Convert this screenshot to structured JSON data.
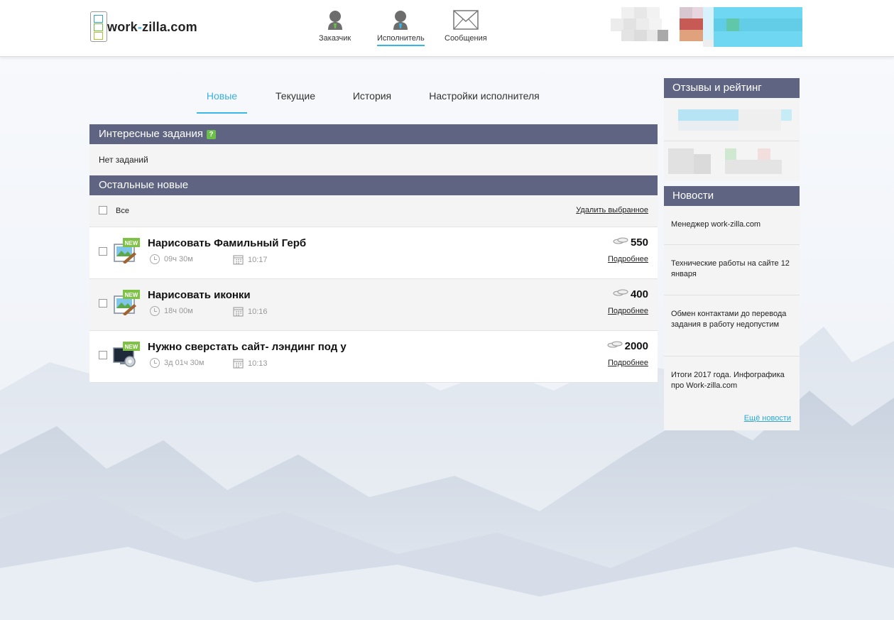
{
  "header": {
    "logo": {
      "text_main": "work",
      "text_dash": "-",
      "text_rest": "zilla.com"
    },
    "nav": [
      {
        "label": "Заказчик",
        "icon": "customer-avatar-icon",
        "active": false
      },
      {
        "label": "Исполнитель",
        "icon": "performer-avatar-icon",
        "active": true
      },
      {
        "label": "Сообщения",
        "icon": "envelope-icon",
        "active": false
      }
    ]
  },
  "tabs": [
    {
      "label": "Новые",
      "active": true
    },
    {
      "label": "Текущие",
      "active": false
    },
    {
      "label": "История",
      "active": false
    },
    {
      "label": "Настройки исполнителя",
      "active": false
    }
  ],
  "interesting": {
    "title": "Интересные задания",
    "help": "?",
    "empty_text": "Нет заданий"
  },
  "others": {
    "title": "Остальные новые",
    "select_all_label": "Все",
    "delete_selected_label": "Удалить выбранное",
    "tasks": [
      {
        "badge": "NEW",
        "title": "Нарисовать Фамильный Герб",
        "time_left": "09ч 30м",
        "time": "10:17",
        "price": "550",
        "more": "Подробнее",
        "icon": "image-edit-icon"
      },
      {
        "badge": "NEW",
        "title": "Нарисовать иконки",
        "time_left": "18ч 00м",
        "time": "10:16",
        "price": "400",
        "more": "Подробнее",
        "icon": "image-edit-icon"
      },
      {
        "badge": "NEW",
        "title": "Нужно сверстать сайт- лэндинг под у",
        "time_left": "3д 01ч 30м",
        "time": "10:13",
        "price": "2000",
        "more": "Подробнее",
        "icon": "monitor-gear-icon"
      }
    ]
  },
  "sidebar": {
    "reviews_title": "Отзывы и рейтинг",
    "news_title": "Новости",
    "news": [
      {
        "text": "Менеджер work-zilla.com"
      },
      {
        "text": "Технические работы на сайте 12 января"
      },
      {
        "text": "Обмен контактами до перевода задания в работу недопустим"
      },
      {
        "text": "Итоги 2017 года. Инфографика про Work-zilla.com"
      }
    ],
    "more_news": "Ещё новости"
  },
  "colors": {
    "accent": "#35b6e6",
    "panel_header": "#5e6481",
    "badge_green": "#6cc04a"
  }
}
